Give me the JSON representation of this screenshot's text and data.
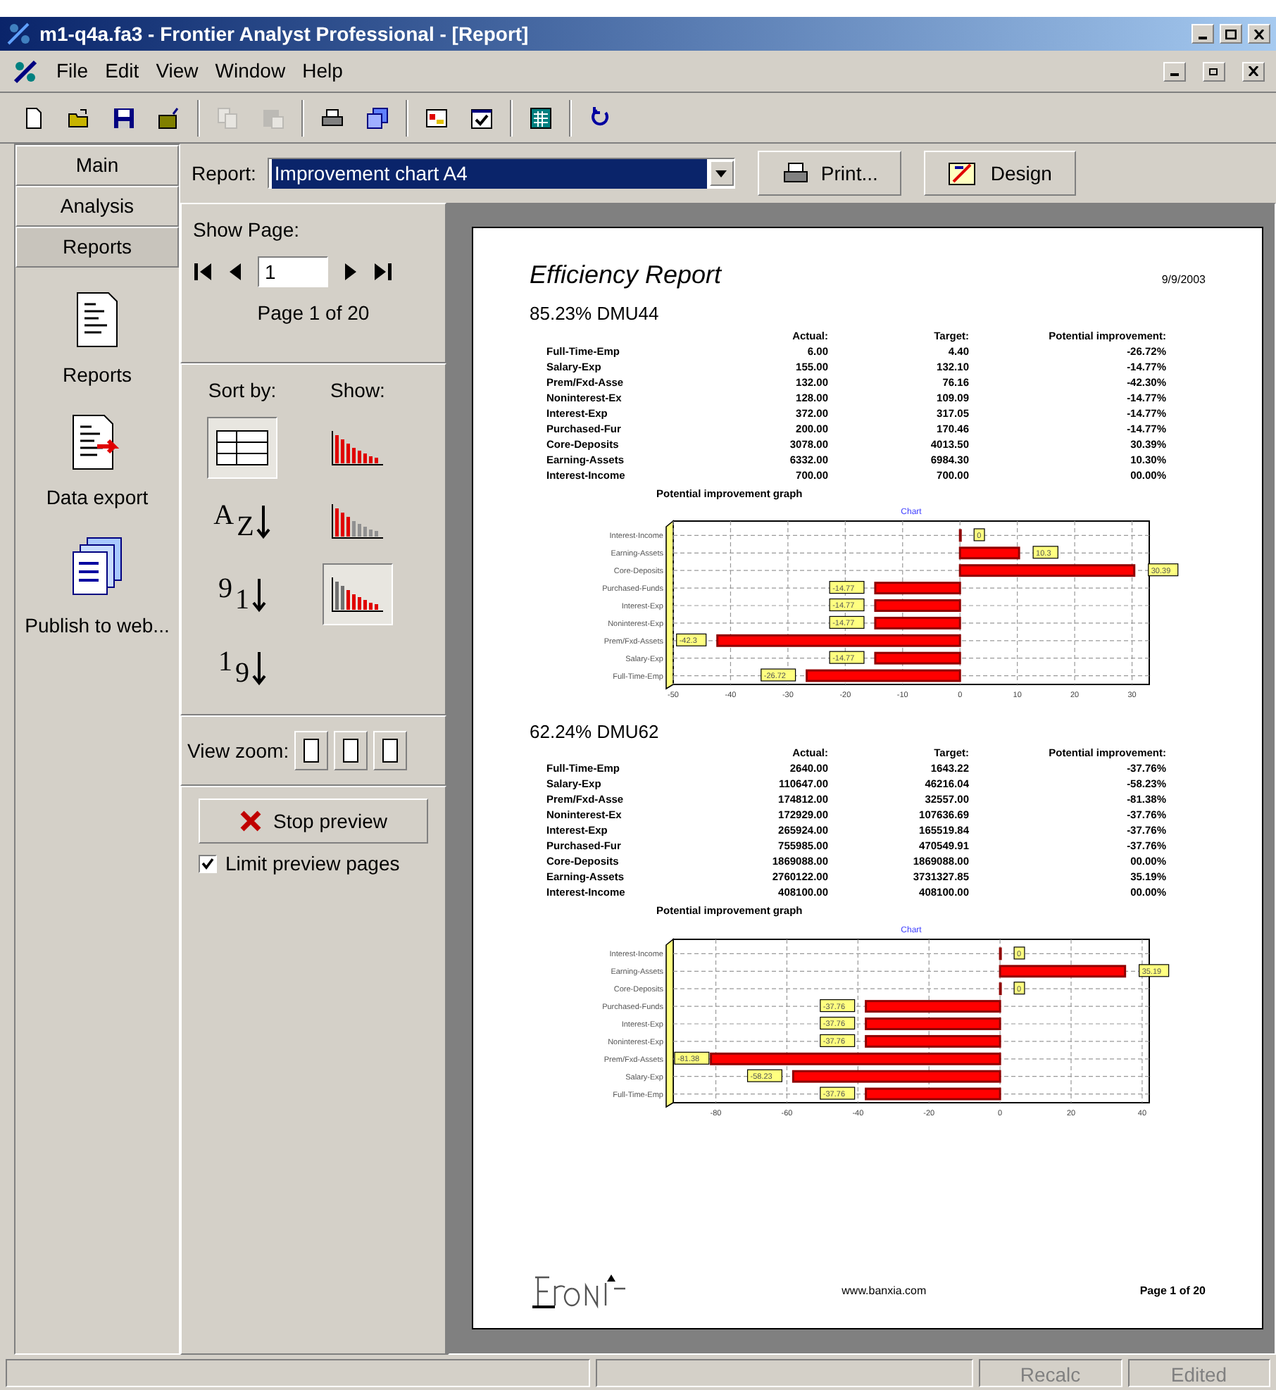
{
  "window": {
    "title": "m1-q4a.fa3 - Frontier Analyst Professional - [Report]"
  },
  "menu": [
    "File",
    "Edit",
    "View",
    "Window",
    "Help"
  ],
  "toolbar": [
    {
      "kind": "new",
      "disabled": false
    },
    {
      "kind": "open",
      "disabled": false
    },
    {
      "kind": "save",
      "disabled": false
    },
    {
      "kind": "export",
      "disabled": false
    },
    {
      "kind": "copy",
      "disabled": true
    },
    {
      "kind": "paste",
      "disabled": true
    },
    {
      "kind": "print",
      "disabled": false
    },
    {
      "kind": "windows",
      "disabled": false
    },
    {
      "kind": "chart",
      "disabled": false
    },
    {
      "kind": "check",
      "disabled": false
    },
    {
      "kind": "calculator",
      "disabled": false
    },
    {
      "kind": "refresh",
      "disabled": false
    }
  ],
  "nav_tabs": [
    {
      "label": "Main",
      "selected": false
    },
    {
      "label": "Analysis",
      "selected": false
    },
    {
      "label": "Reports",
      "selected": true
    }
  ],
  "nav_items": [
    {
      "kind": "report",
      "label": "Reports"
    },
    {
      "kind": "export",
      "label": "Data export"
    },
    {
      "kind": "web",
      "label": "Publish to web..."
    }
  ],
  "report_bar": {
    "label": "Report:",
    "value": "Improvement chart A4",
    "buttons": [
      {
        "kind": "print",
        "label": "Print..."
      },
      {
        "kind": "design",
        "label": "Design"
      }
    ]
  },
  "show_page": {
    "label": "Show Page:",
    "value": "1",
    "status": "Page 1 of 20"
  },
  "sort_by": {
    "label": "Sort by:",
    "options": [
      {
        "kind": "unsorted",
        "selected": true
      },
      {
        "kind": "alpha",
        "glyphs": [
          "A",
          "Z"
        ],
        "selected": false
      },
      {
        "kind": "numeric_desc",
        "glyphs": [
          "9",
          "1"
        ],
        "selected": false
      },
      {
        "kind": "numeric_asc",
        "glyphs": [
          "1",
          "9"
        ],
        "selected": false
      }
    ]
  },
  "show": {
    "label": "Show:",
    "options": [
      {
        "kind": "red",
        "selected": false
      },
      {
        "kind": "mixed",
        "selected": false
      },
      {
        "kind": "grey_red",
        "selected": true
      }
    ]
  },
  "view_zoom": {
    "label": "View zoom:"
  },
  "stop_preview": {
    "label": "Stop preview"
  },
  "limit_preview": {
    "label": "Limit preview pages",
    "checked": true
  },
  "report": {
    "title": "Efficiency Report",
    "date": "9/9/2003",
    "sections": [
      {
        "heading": "85.23% DMU44",
        "columns": [
          "",
          "Actual:",
          "Target:",
          "Potential improvement:"
        ],
        "rows": [
          [
            "Full-Time-Emp",
            "6.00",
            "4.40",
            "-26.72%"
          ],
          [
            "Salary-Exp",
            "155.00",
            "132.10",
            "-14.77%"
          ],
          [
            "Prem/Fxd-Asse",
            "132.00",
            "76.16",
            "-42.30%"
          ],
          [
            "Noninterest-Ex",
            "128.00",
            "109.09",
            "-14.77%"
          ],
          [
            "Interest-Exp",
            "372.00",
            "317.05",
            "-14.77%"
          ],
          [
            "Purchased-Fur",
            "200.00",
            "170.46",
            "-14.77%"
          ],
          [
            "Core-Deposits",
            "3078.00",
            "4013.50",
            "30.39%"
          ],
          [
            "Earning-Assets",
            "6332.00",
            "6984.30",
            "10.30%"
          ],
          [
            "Interest-Income",
            "700.00",
            "700.00",
            "00.00%"
          ]
        ],
        "graph_caption": "Potential improvement graph",
        "chart_data": {
          "type": "bar",
          "orientation": "horizontal",
          "title": "Chart",
          "categories": [
            "Interest-Income",
            "Earning-Assets",
            "Core-Deposits",
            "Purchased-Funds",
            "Interest-Exp",
            "Noninterest-Exp",
            "Prem/Fxd-Assets",
            "Salary-Exp",
            "Full-Time-Emp"
          ],
          "values": [
            0,
            10.3,
            30.39,
            -14.77,
            -14.77,
            -14.77,
            -42.3,
            -14.77,
            -26.72
          ],
          "value_labels": [
            "0",
            "10.3",
            "30.39",
            "-14.77",
            "-14.77",
            "-14.77",
            "-42.3",
            "-14.77",
            "-26.72"
          ],
          "xlim": [
            -50,
            33
          ],
          "xticks": [
            -50,
            -40,
            -30,
            -20,
            -10,
            0,
            10,
            20,
            30
          ],
          "grid": true
        }
      },
      {
        "heading": "62.24% DMU62",
        "columns": [
          "",
          "Actual:",
          "Target:",
          "Potential improvement:"
        ],
        "rows": [
          [
            "Full-Time-Emp",
            "2640.00",
            "1643.22",
            "-37.76%"
          ],
          [
            "Salary-Exp",
            "110647.00",
            "46216.04",
            "-58.23%"
          ],
          [
            "Prem/Fxd-Asse",
            "174812.00",
            "32557.00",
            "-81.38%"
          ],
          [
            "Noninterest-Ex",
            "172929.00",
            "107636.69",
            "-37.76%"
          ],
          [
            "Interest-Exp",
            "265924.00",
            "165519.84",
            "-37.76%"
          ],
          [
            "Purchased-Fur",
            "755985.00",
            "470549.91",
            "-37.76%"
          ],
          [
            "Core-Deposits",
            "1869088.00",
            "1869088.00",
            "00.00%"
          ],
          [
            "Earning-Assets",
            "2760122.00",
            "3731327.85",
            "35.19%"
          ],
          [
            "Interest-Income",
            "408100.00",
            "408100.00",
            "00.00%"
          ]
        ],
        "graph_caption": "Potential improvement graph",
        "chart_data": {
          "type": "bar",
          "orientation": "horizontal",
          "title": "Chart",
          "categories": [
            "Interest-Income",
            "Earning-Assets",
            "Core-Deposits",
            "Purchased-Funds",
            "Interest-Exp",
            "Noninterest-Exp",
            "Prem/Fxd-Assets",
            "Salary-Exp",
            "Full-Time-Emp"
          ],
          "values": [
            0,
            35.19,
            0,
            -37.76,
            -37.76,
            -37.76,
            -81.38,
            -58.23,
            -37.76
          ],
          "value_labels": [
            "0",
            "35.19",
            "0",
            "-37.76",
            "-37.76",
            "-37.76",
            "-81.38",
            "-58.23",
            "-37.76"
          ],
          "xlim": [
            -92,
            42
          ],
          "xticks": [
            -80,
            -60,
            -40,
            -20,
            0,
            20,
            40
          ],
          "grid": true
        }
      }
    ],
    "footer": {
      "url": "www.banxia.com",
      "page": "Page 1 of 20"
    }
  },
  "status_bar": {
    "panels": [
      "Recalc",
      "Edited"
    ]
  }
}
